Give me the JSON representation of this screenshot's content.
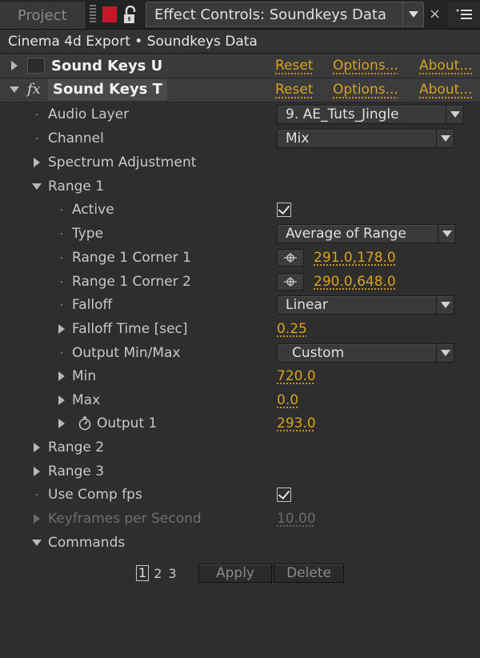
{
  "tabs": {
    "project": "Project",
    "active": "Effect Controls: Soundkeys Data"
  },
  "header": {
    "title": "Cinema 4d Export • Soundkeys Data"
  },
  "effects": [
    {
      "name": "Sound Keys  U",
      "reset": "Reset",
      "options": "Options...",
      "about": "About..."
    },
    {
      "name": "Sound Keys T",
      "reset": "Reset",
      "options": "Options...",
      "about": "About..."
    }
  ],
  "props": {
    "audio_layer": {
      "label": "Audio Layer",
      "value": "9. AE_Tuts_Jingle"
    },
    "channel": {
      "label": "Channel",
      "value": "Mix"
    },
    "spectrum": {
      "label": "Spectrum Adjustment"
    },
    "range1": {
      "label": "Range 1"
    },
    "active": {
      "label": "Active",
      "checked": true
    },
    "type": {
      "label": "Type",
      "value": "Average of Range"
    },
    "corner1": {
      "label": "Range 1 Corner 1",
      "value": "291.0,178.0"
    },
    "corner2": {
      "label": "Range 1 Corner 2",
      "value": "290.0,648.0"
    },
    "falloff": {
      "label": "Falloff",
      "value": "Linear"
    },
    "falloff_time": {
      "label": "Falloff Time [sec]",
      "value": "0.25"
    },
    "output_minmax": {
      "label": "Output Min/Max",
      "value": "Custom"
    },
    "min": {
      "label": "Min",
      "value": "720.0"
    },
    "max": {
      "label": "Max",
      "value": "0.0"
    },
    "output1": {
      "label": "Output 1",
      "value": "293.0"
    },
    "range2": {
      "label": "Range 2"
    },
    "range3": {
      "label": "Range 3"
    },
    "use_comp_fps": {
      "label": "Use Comp fps",
      "checked": true
    },
    "kps": {
      "label": "Keyframes per Second",
      "value": "10.00"
    },
    "commands": {
      "label": "Commands"
    }
  },
  "commands": {
    "pages": [
      "1",
      "2",
      "3"
    ],
    "apply": "Apply",
    "delete": "Delete"
  },
  "colors": {
    "accent": "#d9a21f",
    "red_swatch": "#c2182a"
  }
}
